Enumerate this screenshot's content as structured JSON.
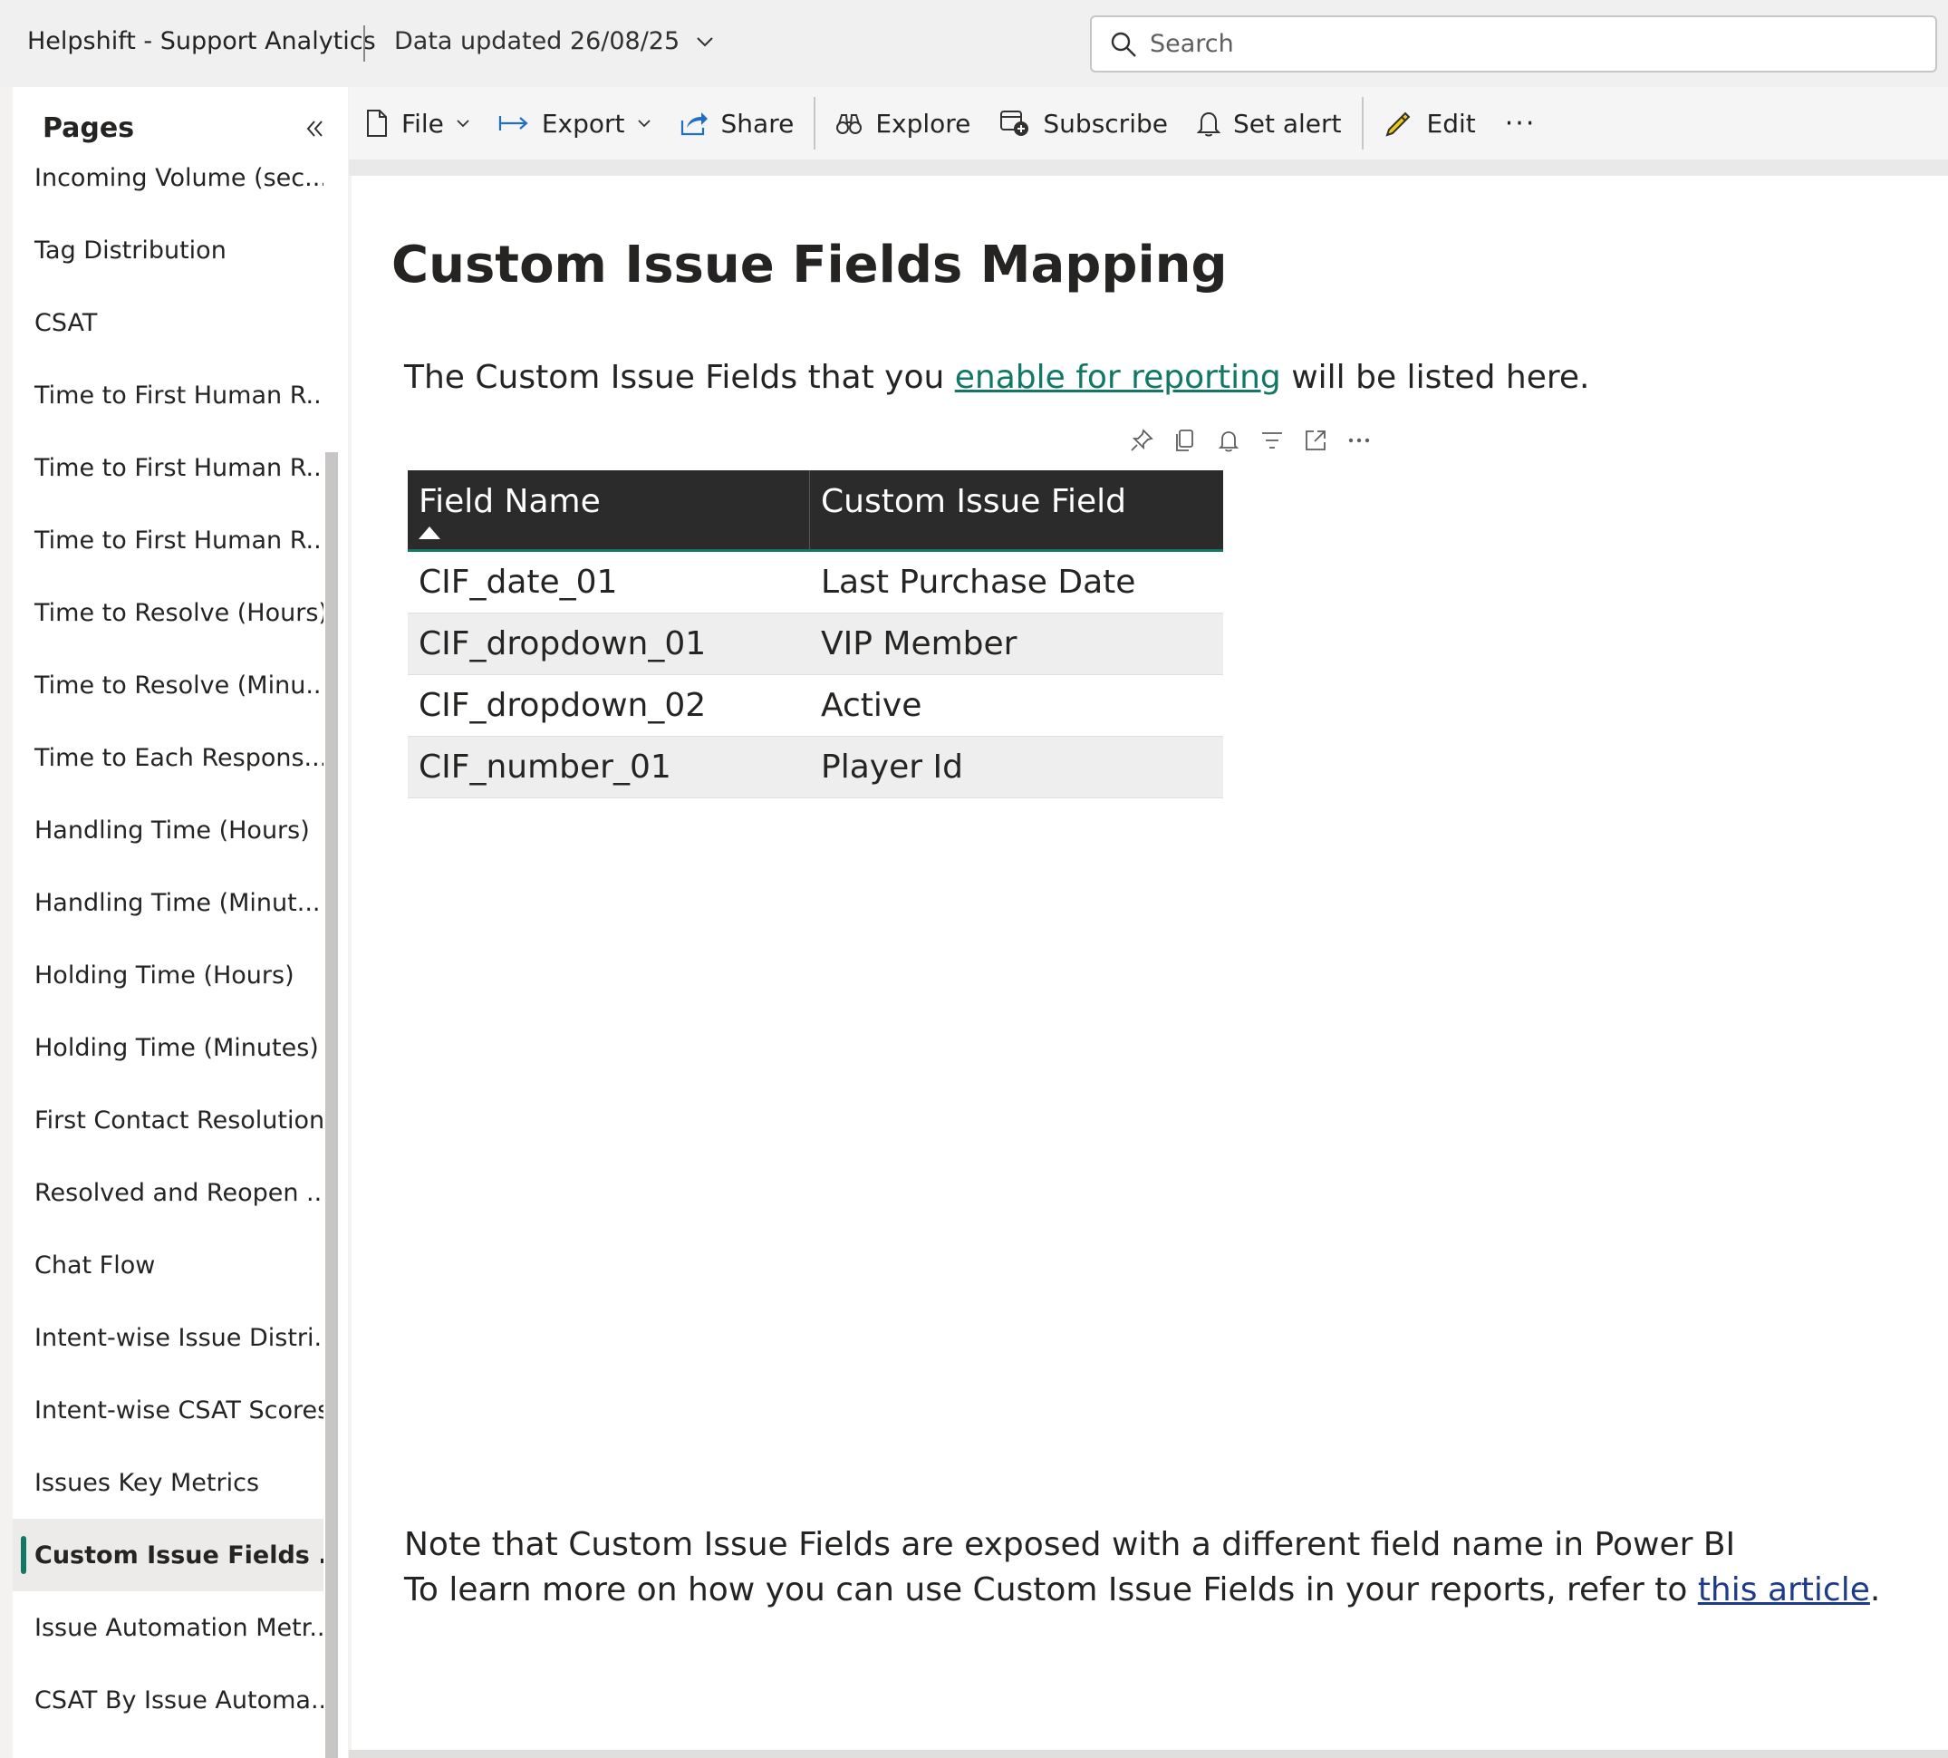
{
  "header": {
    "app_title": "Helpshift - Support Analytics",
    "data_updated": "Data updated 26/08/25",
    "search_placeholder": "Search"
  },
  "sidebar": {
    "heading": "Pages",
    "items": [
      {
        "label": "Incoming Volume (sec...",
        "active": false
      },
      {
        "label": "Tag Distribution",
        "active": false
      },
      {
        "label": "CSAT",
        "active": false
      },
      {
        "label": "Time to First Human R...",
        "active": false
      },
      {
        "label": "Time to First Human R...",
        "active": false
      },
      {
        "label": "Time to First Human R...",
        "active": false
      },
      {
        "label": "Time to Resolve (Hours)",
        "active": false
      },
      {
        "label": "Time to Resolve (Minu...",
        "active": false
      },
      {
        "label": "Time to Each Respons...",
        "active": false
      },
      {
        "label": "Handling Time (Hours)",
        "active": false
      },
      {
        "label": "Handling Time (Minut...",
        "active": false
      },
      {
        "label": "Holding Time (Hours)",
        "active": false
      },
      {
        "label": "Holding Time (Minutes)",
        "active": false
      },
      {
        "label": "First Contact Resolution",
        "active": false
      },
      {
        "label": "Resolved and Reopen ...",
        "active": false
      },
      {
        "label": "Chat Flow",
        "active": false
      },
      {
        "label": "Intent-wise Issue Distri...",
        "active": false
      },
      {
        "label": "Intent-wise CSAT Scores",
        "active": false
      },
      {
        "label": "Issues Key Metrics",
        "active": false
      },
      {
        "label": "Custom Issue Fields ...",
        "active": true
      },
      {
        "label": "Issue Automation Metr...",
        "active": false
      },
      {
        "label": "CSAT By Issue Automa...",
        "active": false
      }
    ]
  },
  "toolbar": {
    "file": "File",
    "export": "Export",
    "share": "Share",
    "explore": "Explore",
    "subscribe": "Subscribe",
    "set_alert": "Set alert",
    "edit": "Edit",
    "more": "···"
  },
  "report": {
    "title": "Custom Issue Fields Mapping",
    "intro_before": "The Custom Issue Fields that you ",
    "intro_link": "enable for reporting",
    "intro_after": " will be listed here.",
    "table": {
      "headers": [
        "Field Name",
        "Custom Issue Field"
      ],
      "rows": [
        [
          "CIF_date_01",
          "Last Purchase Date"
        ],
        [
          "CIF_dropdown_01",
          "VIP Member"
        ],
        [
          "CIF_dropdown_02",
          "Active"
        ],
        [
          "CIF_number_01",
          "Player Id"
        ]
      ]
    },
    "note_line1": "Note that Custom Issue Fields are exposed with a different field name in Power BI",
    "note_line2_before": "To learn more on how you can use Custom Issue Fields in your reports, refer to ",
    "note_link": "this article",
    "note_line2_after": "."
  },
  "colors": {
    "accent": "#117865",
    "table_header_bg": "#2b2b2b",
    "link_blue": "#1e3a8a"
  }
}
